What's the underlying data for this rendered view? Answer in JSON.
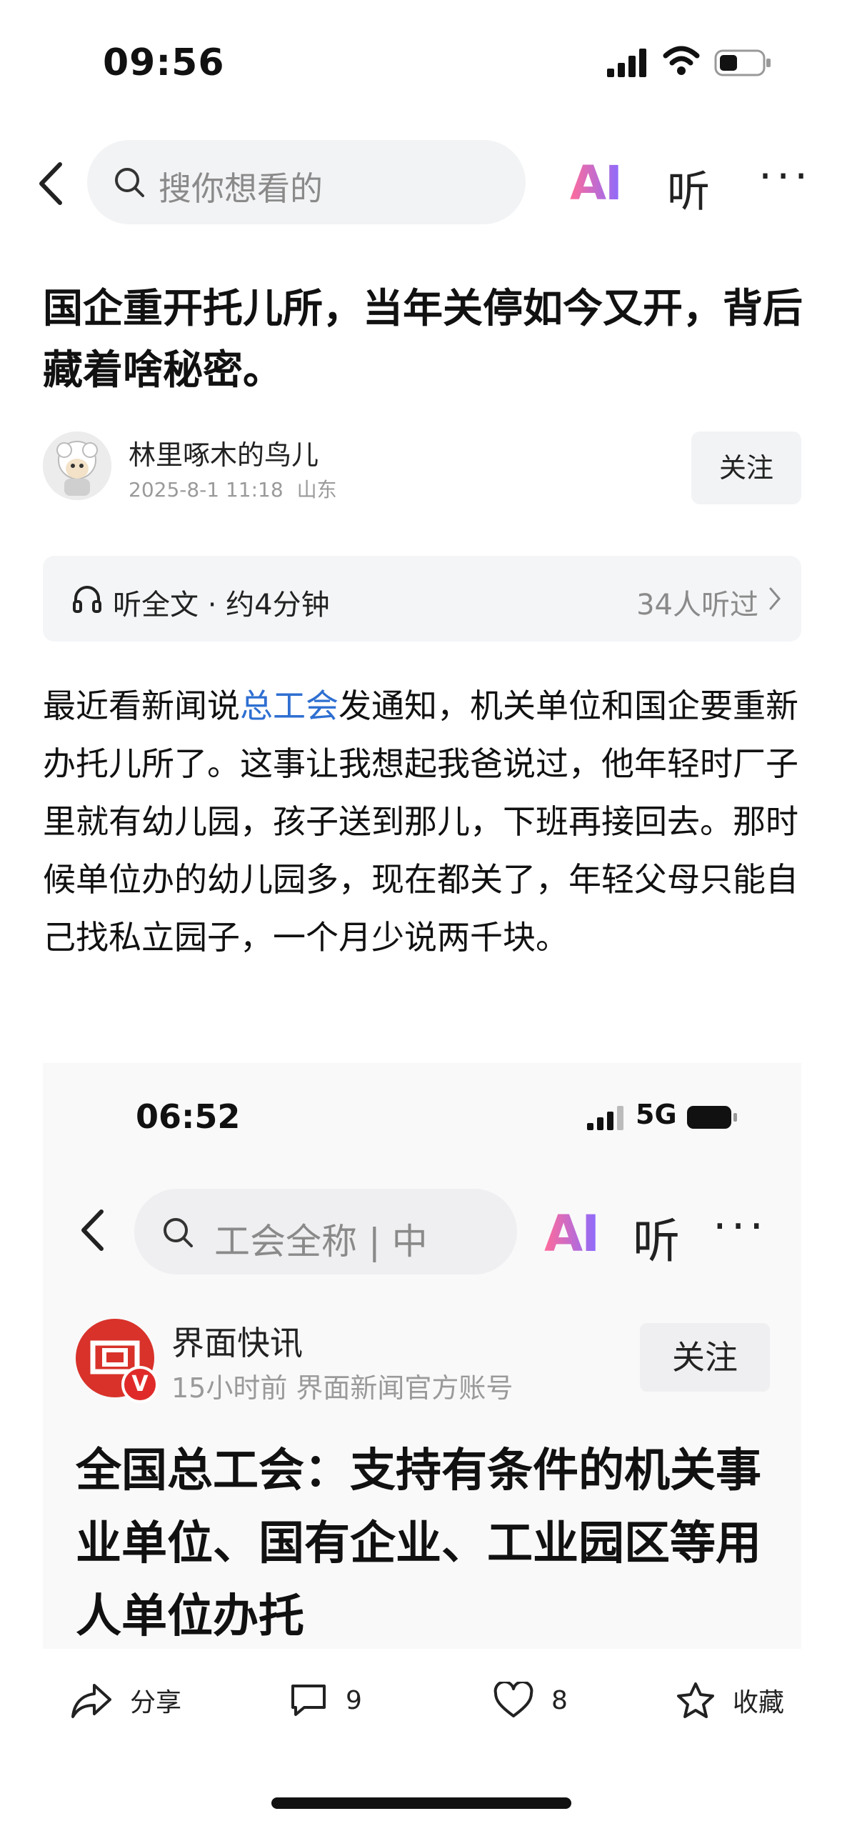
{
  "status_bar": {
    "time": "09:56"
  },
  "nav": {
    "search_placeholder": "搜你想看的",
    "ai_label": "AI",
    "listen_label": "听",
    "more_label": "···"
  },
  "article": {
    "title": "国企重开托儿所，当年关停如今又开，背后藏着啥秘密。",
    "author": {
      "name": "林里啄木的鸟儿",
      "date": "2025-8-1  11:18",
      "location": "山东",
      "follow_label": "关注"
    },
    "listen_bar": {
      "label": "听全文 · 约4分钟",
      "count": "34人听过"
    },
    "body": {
      "before_link": "最近看新闻说",
      "link": "总工会",
      "after_link": "发通知，机关单位和国企要重新办托儿所了。这事让我想起我爸说过，他年轻时厂子里就有幼儿园，孩子送到那儿，下班再接回去。那时候单位办的幼儿园多，现在都关了，年轻父母只能自己找私立园子，一个月少说两千块。"
    }
  },
  "embedded": {
    "time": "06:52",
    "network": "5G",
    "search_text": "工会全称 | 中",
    "ai_label": "AI",
    "listen_label": "听",
    "more_label": "···",
    "source_name": "界面快讯",
    "source_meta": "15小时前  界面新闻官方账号",
    "badge": "V",
    "follow_label": "关注",
    "headline": "全国总工会：支持有条件的机关事业单位、国有企业、工业园区等用人单位办托"
  },
  "actions": {
    "share_label": "分享",
    "comment_count": "9",
    "like_count": "8",
    "favorite_label": "收藏"
  },
  "colors": {
    "link": "#2e6fd1",
    "ai_gradient_start": "#ff6b9a",
    "ai_gradient_end": "#8a6bff",
    "badge_red": "#e02a2a"
  }
}
